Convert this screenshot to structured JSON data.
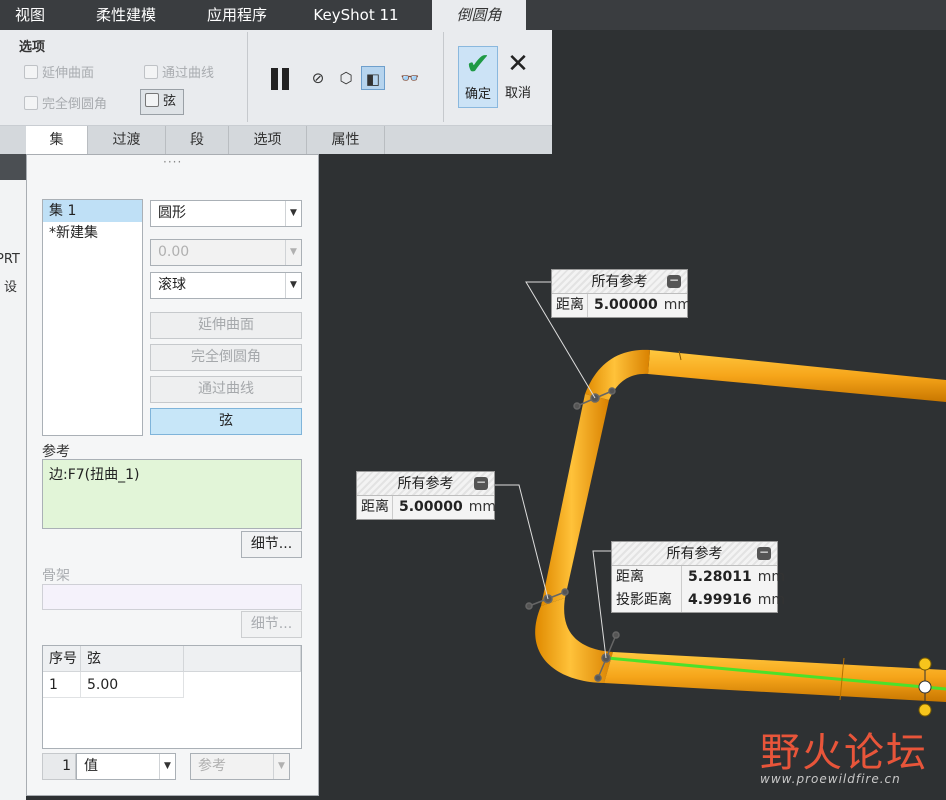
{
  "top_tabs": [
    "视图",
    "柔性建模",
    "应用程序",
    "KeyShot 11",
    "倒圆角"
  ],
  "ribbon": {
    "options_title": "选项",
    "extend_surface": "延伸曲面",
    "through_curve": "通过曲线",
    "full_round": "完全倒圆角",
    "chord": "弦",
    "confirm": "确定",
    "cancel": "取消"
  },
  "sub_tabs": [
    "集",
    "过渡",
    "段",
    "选项",
    "属性"
  ],
  "left_strip": [
    "PRT",
    "设"
  ],
  "panel": {
    "sets": [
      "集 1",
      "*新建集"
    ],
    "cross_section": "圆形",
    "conic_value": "0.00",
    "method": "滚球",
    "extend_surface_btn": "延伸曲面",
    "full_round_btn": "完全倒圆角",
    "through_curve_btn": "通过曲线",
    "chord_btn": "弦",
    "references_label": "参考",
    "reference_value": "边:F7(扭曲_1)",
    "details_btn": "细节...",
    "skeleton_label": "骨架",
    "skeleton_details_btn": "细节...",
    "table": {
      "headers": [
        "序号",
        "弦"
      ],
      "rows": [
        {
          "index": "1",
          "value": "5.00"
        }
      ]
    },
    "bottom_index": "1",
    "bottom_value_type": "值",
    "bottom_ref": "参考"
  },
  "callouts": [
    {
      "title": "所有参考",
      "rows": [
        {
          "label": "距离",
          "value": "5.00000",
          "unit": "mm"
        }
      ]
    },
    {
      "title": "所有参考",
      "rows": [
        {
          "label": "距离",
          "value": "5.00000",
          "unit": "mm"
        }
      ]
    },
    {
      "title": "所有参考",
      "rows": [
        {
          "label": "距离",
          "value": "5.28011",
          "unit": "mm"
        },
        {
          "label": "投影距离",
          "value": "4.99916",
          "unit": "mm"
        }
      ]
    }
  ],
  "watermark": {
    "main": "野火论坛",
    "url": "www.proewildfire.cn"
  },
  "colors": {
    "tube": "#f5a91c",
    "highlight": "#4ce12a",
    "selection": "#bfe0f6",
    "accent_ok": "#1f9a45",
    "watermark": "#e8553a"
  }
}
